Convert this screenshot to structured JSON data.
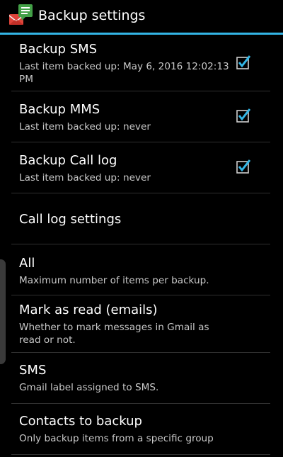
{
  "header": {
    "title": "Backup settings",
    "app_icon": "sms-backup-icon"
  },
  "colors": {
    "accent": "#33b5e5",
    "check": "#33b5e5",
    "background": "#000000",
    "summary_text": "#c8c8c8"
  },
  "preferences": [
    {
      "title": "Backup SMS",
      "summary": "Last item backed up: May 6, 2016 12:02:13 PM",
      "checked": true
    },
    {
      "title": "Backup MMS",
      "summary": "Last item backed up: never",
      "checked": true
    },
    {
      "title": "Backup Call log",
      "summary": "Last item backed up: never",
      "checked": true
    },
    {
      "title": "Call log settings"
    },
    {
      "title": "All",
      "summary": "Maximum number of items per backup."
    },
    {
      "title": "Mark as read (emails)",
      "summary": "Whether to mark messages in Gmail as read or not."
    },
    {
      "title": "SMS",
      "summary": "Gmail label assigned to SMS."
    },
    {
      "title": "Contacts to backup",
      "summary": "Only backup items from a specific group"
    }
  ]
}
